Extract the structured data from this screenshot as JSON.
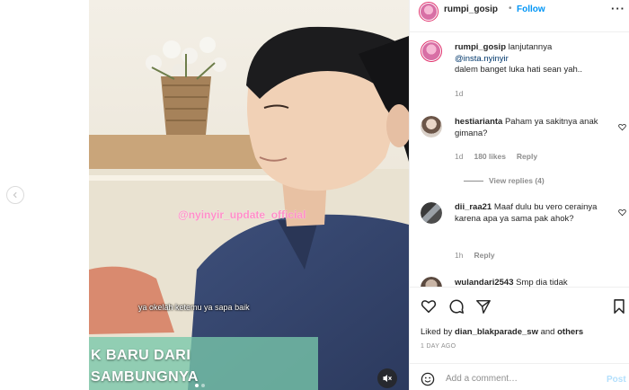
{
  "post": {
    "username": "rumpi_gosip",
    "separator": "•",
    "follow_label": "Follow",
    "more_label": "···"
  },
  "media": {
    "watermark": "@nyinyir_update_official",
    "video_caption": "ya okelah ketemu ya sapa baik",
    "banner_line1": "K BARU DARI",
    "banner_line2": "SAMBUNGNYA"
  },
  "caption": {
    "username": "rumpi_gosip",
    "text_before": "lanjutannya",
    "mention": "@insta.nyinyir",
    "text_after": "dalem banget luka hati sean yah..",
    "age": "1d"
  },
  "comments": [
    {
      "username": "hestiarianta",
      "text": "Paham ya sakitnya anak gimana?",
      "age": "1d",
      "likes": "180 likes",
      "reply_label": "Reply",
      "view_replies": "View replies (4)"
    },
    {
      "username": "dii_raa21",
      "text": "Maaf dulu bu vero cerainya karena apa ya sama pak ahok?",
      "age": "1h",
      "reply_label": "Reply"
    },
    {
      "username": "wulandari2543",
      "text": "Smp dia tidak"
    }
  ],
  "actions": {
    "liked_by_prefix": "Liked by",
    "liked_by_user": "dian_blakparade_sw",
    "liked_by_and": "and",
    "liked_by_others": "others",
    "date": "1 DAY AGO"
  },
  "add_comment": {
    "placeholder": "Add a comment…",
    "post_label": "Post"
  },
  "icons": {
    "prev": "chevron-left-icon",
    "mute": "speaker-muted-icon",
    "like": "heart-icon",
    "comment": "comment-bubble-icon",
    "share": "paper-plane-icon",
    "save": "bookmark-icon",
    "emoji": "smiley-icon"
  },
  "colors": {
    "follow": "#0095f6",
    "secondary_text": "#8e8e8e",
    "watermark": "#ff8fc8",
    "banner": "#78c8aa",
    "post_disabled": "#b2dffc"
  }
}
